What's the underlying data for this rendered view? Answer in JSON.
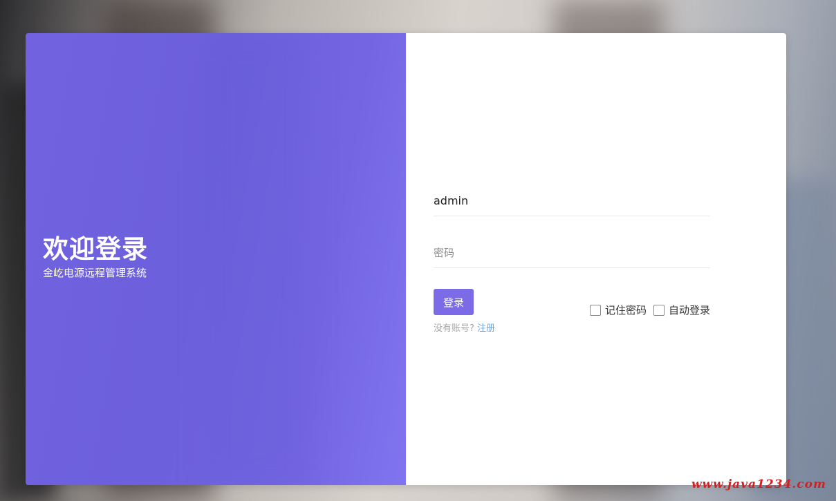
{
  "left": {
    "title": "欢迎登录",
    "subtitle": "金屹电源远程管理系统",
    "accent_color": "#7262e0"
  },
  "form": {
    "username_value": "admin",
    "password_placeholder": "密码",
    "login_label": "登录",
    "remember_label": "记住密码",
    "auto_login_label": "自动登录",
    "no_account_text": "没有账号?",
    "register_label": "注册",
    "button_color": "#7b6be6",
    "link_color": "#6aa8e8"
  },
  "watermark": "www.java1234.com"
}
